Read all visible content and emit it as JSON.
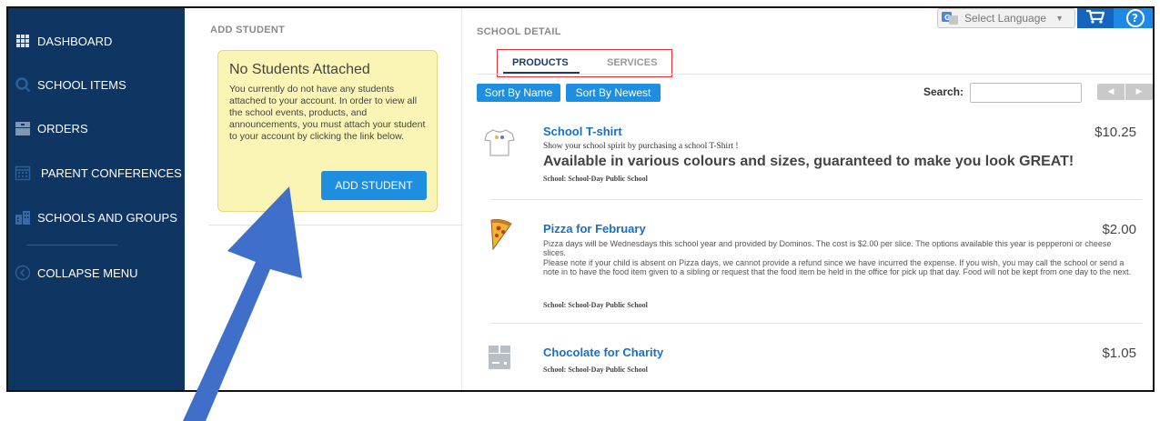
{
  "sidebar": {
    "items": [
      {
        "label": "DASHBOARD",
        "icon": "grid-icon"
      },
      {
        "label": "SCHOOL ITEMS",
        "icon": "search-icon"
      },
      {
        "label": "ORDERS",
        "icon": "box-icon"
      },
      {
        "label": "PARENT CONFERENCES",
        "icon": "calendar-icon"
      },
      {
        "label": "SCHOOLS AND GROUPS",
        "icon": "building-icon"
      },
      {
        "label": "COLLAPSE MENU",
        "icon": "chevron-left-circle-icon"
      }
    ]
  },
  "add_student": {
    "section_title": "ADD STUDENT",
    "notice_title": "No Students Attached",
    "notice_text": "You currently do not have any students attached to your account. In order to view all the school events, products, and announcements, you must attach your student to your account by clicking the link below.",
    "button_label": "ADD STUDENT"
  },
  "school_detail": {
    "section_title": "SCHOOL DETAIL",
    "tabs": [
      {
        "label": "PRODUCTS",
        "active": true
      },
      {
        "label": "SERVICES",
        "active": false
      }
    ],
    "sort_buttons": [
      "Sort By Name",
      "Sort By Newest"
    ],
    "search_label": "Search:",
    "search_value": "",
    "pager": [
      "◀",
      "▶"
    ]
  },
  "header": {
    "language_label": "Select Language",
    "language_arrow": "▼",
    "help_glyph": "?"
  },
  "products": [
    {
      "name": "School T-shirt",
      "price": "$10.25",
      "desc": "Show your school spirit by purchasing a school T-Shirt !",
      "highlight": "Available in various colours and sizes, guaranteed to make you look GREAT!",
      "school": "School: School-Day Public School",
      "icon": "tshirt-icon"
    },
    {
      "name": "Pizza for February",
      "price": "$2.00",
      "body": "Pizza days will be Wednesdays this school year and provided by Dominos.  The cost is $2.00 per slice.  The options available this year is pepperoni or cheese slices.",
      "body2": "Please note if your child is absent on Pizza days, we cannot provide a refund since we have incurred the expense.  If you wish, you may call the school or send a note in to have the food item given to a sibling or request that the food item be held in the office for pick up that day.  Food will not be kept from one day to the next.",
      "school": "School: School-Day Public School",
      "icon": "pizza-icon"
    },
    {
      "name": "Chocolate for Charity",
      "price": "$1.05",
      "school": "School: School-Day Public School",
      "icon": "package-icon"
    }
  ],
  "colors": {
    "sidebar_bg": "#0f3563",
    "accent_blue": "#1e8fe0",
    "tab_active": "#1e3a6b",
    "highlight_box": "#d33333",
    "notice_bg": "#fbf5b5",
    "arrow": "#3f6fc9"
  }
}
